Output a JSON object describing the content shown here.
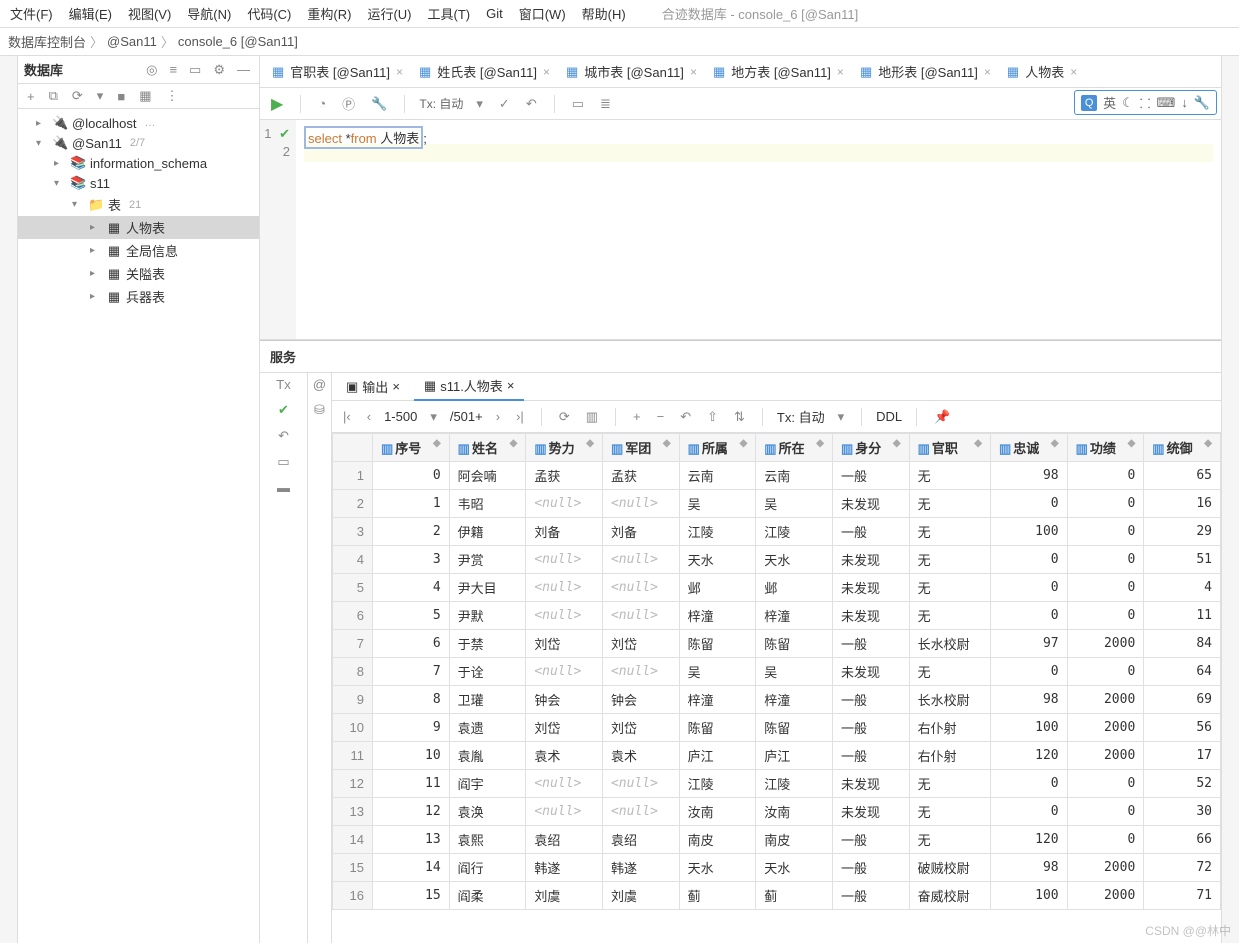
{
  "window": {
    "title": "合迹数据库 - console_6 [@San11]"
  },
  "menu": [
    "文件(F)",
    "编辑(E)",
    "视图(V)",
    "导航(N)",
    "代码(C)",
    "重构(R)",
    "运行(U)",
    "工具(T)",
    "Git",
    "窗口(W)",
    "帮助(H)"
  ],
  "crumbs": [
    "数据库控制台",
    "@San11",
    "console_6 [@San11]"
  ],
  "dbpanel": {
    "title": "数据库",
    "tree": {
      "localhost": "@localhost",
      "san11": "@San11",
      "san11_cnt": "2/7",
      "infoschema": "information_schema",
      "s11": "s11",
      "tables": "表",
      "tables_cnt": "21",
      "t1": "人物表",
      "t2": "全局信息",
      "t3": "关隘表",
      "t4": "兵器表"
    }
  },
  "editor_tabs": [
    {
      "label": "官职表 [@San11]"
    },
    {
      "label": "姓氏表 [@San11]"
    },
    {
      "label": "城市表 [@San11]"
    },
    {
      "label": "地方表 [@San11]"
    },
    {
      "label": "地形表 [@San11]"
    },
    {
      "label": "人物表"
    }
  ],
  "tx_label": "Tx: 自动",
  "ime": {
    "lang": "英"
  },
  "sql": {
    "kw1": "select",
    "star": " *",
    "kw2": "from",
    "tbl": " 人物表",
    "semi": ";"
  },
  "services_title": "服务",
  "restabs": {
    "out": "输出",
    "tbl": "s11.人物表"
  },
  "pager": {
    "range": "1-500",
    "total": "/501+"
  },
  "ddl": "DDL",
  "columns": [
    "序号",
    "姓名",
    "势力",
    "军团",
    "所属",
    "所在",
    "身分",
    "官职",
    "忠诚",
    "功绩",
    "统御"
  ],
  "rows": [
    {
      "n": 1,
      "序号": 0,
      "姓名": "阿会喃",
      "势力": "孟获",
      "军团": "孟获",
      "所属": "云南",
      "所在": "云南",
      "身分": "一般",
      "官职": "无",
      "忠诚": 98,
      "功绩": 0,
      "统御": 65
    },
    {
      "n": 2,
      "序号": 1,
      "姓名": "韦昭",
      "势力": null,
      "军团": null,
      "所属": "吴",
      "所在": "吴",
      "身分": "未发现",
      "官职": "无",
      "忠诚": 0,
      "功绩": 0,
      "统御": 16
    },
    {
      "n": 3,
      "序号": 2,
      "姓名": "伊籍",
      "势力": "刘备",
      "军团": "刘备",
      "所属": "江陵",
      "所在": "江陵",
      "身分": "一般",
      "官职": "无",
      "忠诚": 100,
      "功绩": 0,
      "统御": 29
    },
    {
      "n": 4,
      "序号": 3,
      "姓名": "尹赏",
      "势力": null,
      "军团": null,
      "所属": "天水",
      "所在": "天水",
      "身分": "未发现",
      "官职": "无",
      "忠诚": 0,
      "功绩": 0,
      "统御": 51
    },
    {
      "n": 5,
      "序号": 4,
      "姓名": "尹大目",
      "势力": null,
      "军团": null,
      "所属": "邺",
      "所在": "邺",
      "身分": "未发现",
      "官职": "无",
      "忠诚": 0,
      "功绩": 0,
      "统御": 4
    },
    {
      "n": 6,
      "序号": 5,
      "姓名": "尹默",
      "势力": null,
      "军团": null,
      "所属": "梓潼",
      "所在": "梓潼",
      "身分": "未发现",
      "官职": "无",
      "忠诚": 0,
      "功绩": 0,
      "统御": 11
    },
    {
      "n": 7,
      "序号": 6,
      "姓名": "于禁",
      "势力": "刘岱",
      "军团": "刘岱",
      "所属": "陈留",
      "所在": "陈留",
      "身分": "一般",
      "官职": "长水校尉",
      "忠诚": 97,
      "功绩": 2000,
      "统御": 84
    },
    {
      "n": 8,
      "序号": 7,
      "姓名": "于诠",
      "势力": null,
      "军团": null,
      "所属": "吴",
      "所在": "吴",
      "身分": "未发现",
      "官职": "无",
      "忠诚": 0,
      "功绩": 0,
      "统御": 64
    },
    {
      "n": 9,
      "序号": 8,
      "姓名": "卫瓘",
      "势力": "钟会",
      "军团": "钟会",
      "所属": "梓潼",
      "所在": "梓潼",
      "身分": "一般",
      "官职": "长水校尉",
      "忠诚": 98,
      "功绩": 2000,
      "统御": 69
    },
    {
      "n": 10,
      "序号": 9,
      "姓名": "袁遗",
      "势力": "刘岱",
      "军团": "刘岱",
      "所属": "陈留",
      "所在": "陈留",
      "身分": "一般",
      "官职": "右仆射",
      "忠诚": 100,
      "功绩": 2000,
      "统御": 56
    },
    {
      "n": 11,
      "序号": 10,
      "姓名": "袁胤",
      "势力": "袁术",
      "军团": "袁术",
      "所属": "庐江",
      "所在": "庐江",
      "身分": "一般",
      "官职": "右仆射",
      "忠诚": 120,
      "功绩": 2000,
      "统御": 17
    },
    {
      "n": 12,
      "序号": 11,
      "姓名": "阎宇",
      "势力": null,
      "军团": null,
      "所属": "江陵",
      "所在": "江陵",
      "身分": "未发现",
      "官职": "无",
      "忠诚": 0,
      "功绩": 0,
      "统御": 52
    },
    {
      "n": 13,
      "序号": 12,
      "姓名": "袁涣",
      "势力": null,
      "军团": null,
      "所属": "汝南",
      "所在": "汝南",
      "身分": "未发现",
      "官职": "无",
      "忠诚": 0,
      "功绩": 0,
      "统御": 30
    },
    {
      "n": 14,
      "序号": 13,
      "姓名": "袁熙",
      "势力": "袁绍",
      "军团": "袁绍",
      "所属": "南皮",
      "所在": "南皮",
      "身分": "一般",
      "官职": "无",
      "忠诚": 120,
      "功绩": 0,
      "统御": 66
    },
    {
      "n": 15,
      "序号": 14,
      "姓名": "阎行",
      "势力": "韩遂",
      "军团": "韩遂",
      "所属": "天水",
      "所在": "天水",
      "身分": "一般",
      "官职": "破贼校尉",
      "忠诚": 98,
      "功绩": 2000,
      "统御": 72
    },
    {
      "n": 16,
      "序号": 15,
      "姓名": "阎柔",
      "势力": "刘虞",
      "军团": "刘虞",
      "所属": "蓟",
      "所在": "蓟",
      "身分": "一般",
      "官职": "奋威校尉",
      "忠诚": 100,
      "功绩": 2000,
      "统御": 71
    }
  ],
  "watermark": "CSDN @@林中"
}
